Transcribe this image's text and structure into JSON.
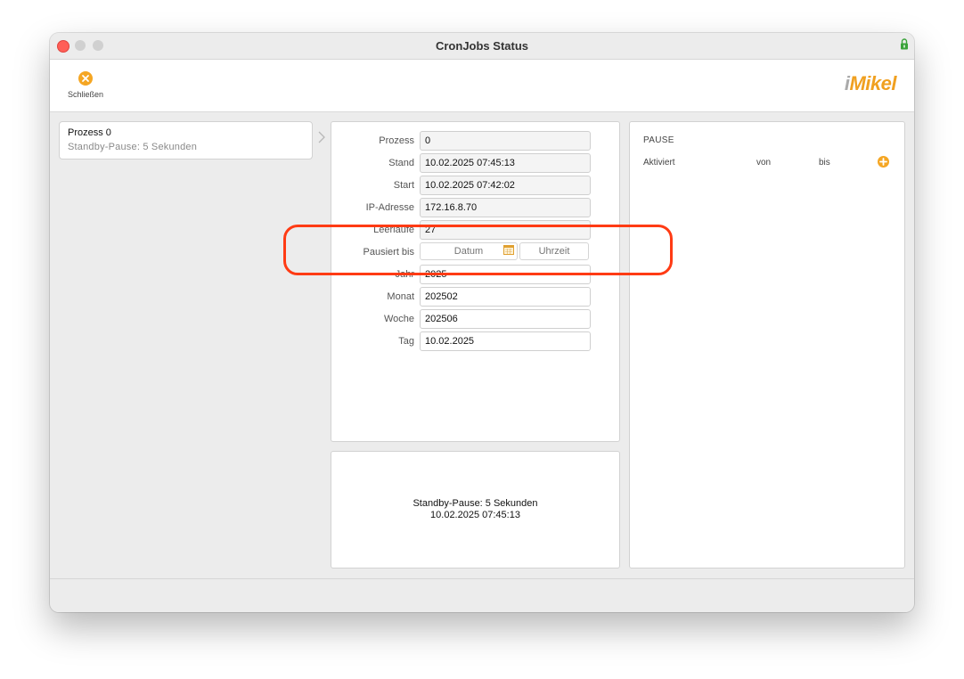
{
  "window": {
    "title": "CronJobs Status"
  },
  "toolbar": {
    "close_label": "Schließen",
    "logo_text": "Mikel",
    "logo_prefix": "i"
  },
  "process_list": [
    {
      "title": "Prozess 0",
      "subtitle": "Standby-Pause: 5 Sekunden"
    }
  ],
  "form": {
    "prozess": {
      "label": "Prozess",
      "value": "0"
    },
    "stand": {
      "label": "Stand",
      "value": "10.02.2025 07:45:13"
    },
    "start": {
      "label": "Start",
      "value": "10.02.2025 07:42:02"
    },
    "ip": {
      "label": "IP-Adresse",
      "value": "172.16.8.70"
    },
    "leerlaeufe": {
      "label": "Leerläufe",
      "value": "27"
    },
    "pausiert": {
      "label": "Pausiert bis",
      "date_placeholder": "Datum",
      "time_placeholder": "Uhrzeit"
    },
    "jahr": {
      "label": "Jahr",
      "value": "2025"
    },
    "monat": {
      "label": "Monat",
      "value": "202502"
    },
    "woche": {
      "label": "Woche",
      "value": "202506"
    },
    "tag": {
      "label": "Tag",
      "value": "10.02.2025"
    }
  },
  "message": {
    "line1": "Standby-Pause: 5 Sekunden",
    "line2": "10.02.2025 07:45:13"
  },
  "pause_panel": {
    "title": "PAUSE",
    "columns": [
      "Aktiviert",
      "von",
      "bis"
    ]
  },
  "colors": {
    "accent": "#f5a623",
    "highlight": "#ff3b14"
  }
}
